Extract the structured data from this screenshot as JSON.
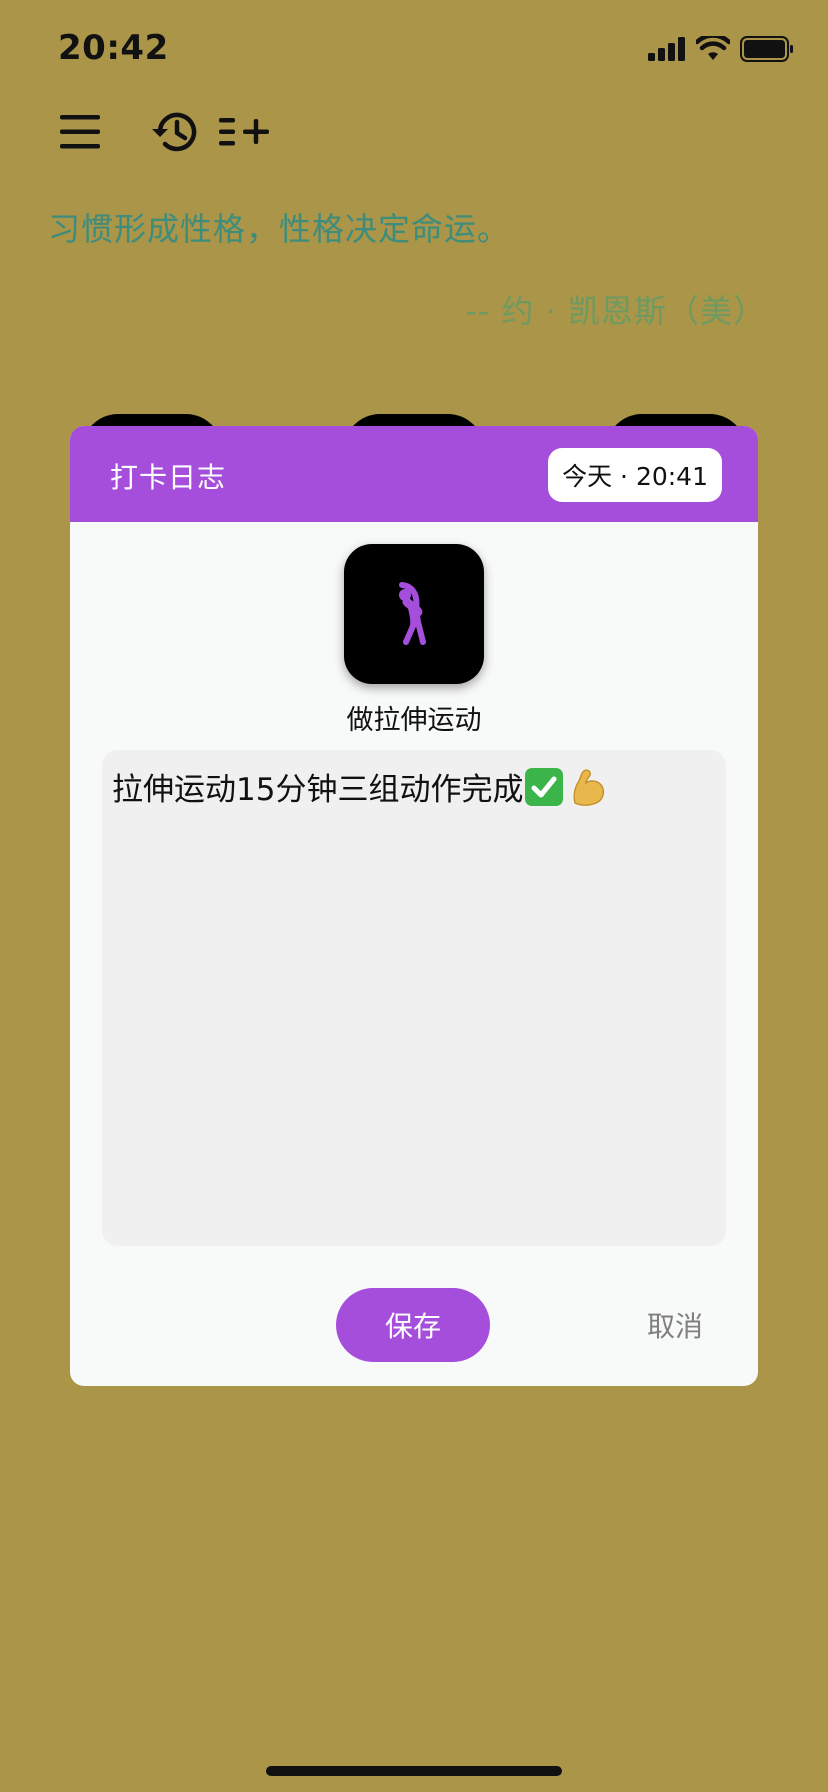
{
  "status_bar": {
    "time": "20:42"
  },
  "toolbar": {
    "menu_icon": "menu-icon",
    "history_icon": "history-icon",
    "add_list_icon": "playlist-add-icon"
  },
  "quote": {
    "text": "习惯形成性格，性格决定命运。",
    "author": "-- 约 · 凯恩斯（美）"
  },
  "modal": {
    "title": "打卡日志",
    "date_chip": "今天 · 20:41",
    "habit_icon": "stretching-person-icon",
    "habit_name": "做拉伸运动",
    "note": "拉伸运动15分钟三组动作完成",
    "note_emojis": [
      "check-mark-button-emoji",
      "flexed-biceps-emoji"
    ],
    "save_label": "保存",
    "cancel_label": "取消"
  },
  "colors": {
    "background": "#AA9548",
    "accent": "#A64EDC",
    "quote": "#3E8C7C",
    "author": "#6E9A62",
    "modal_bg": "#F8F9F9",
    "note_bg": "#F0F0F0"
  }
}
